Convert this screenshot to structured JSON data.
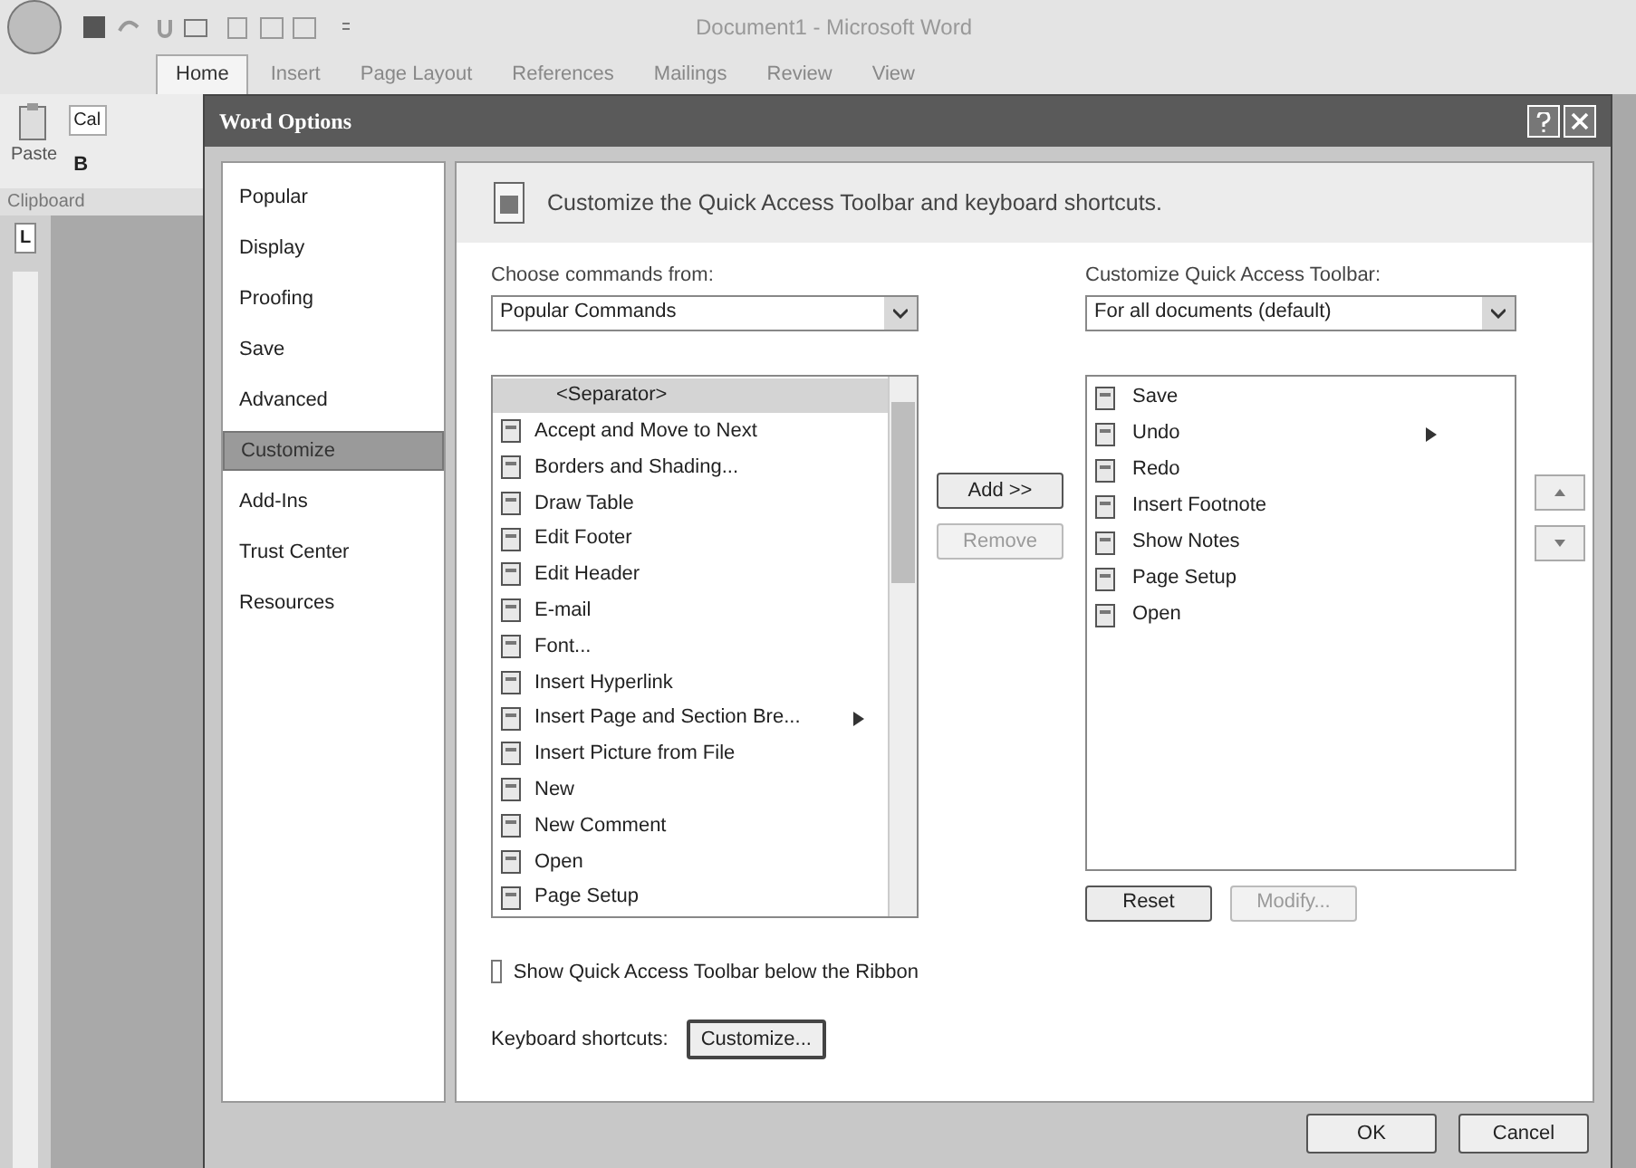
{
  "word_window": {
    "title": "Document1 - Microsoft Word",
    "ribbon_tabs": [
      {
        "label": "Home",
        "selected": true
      },
      {
        "label": "Insert",
        "selected": false
      },
      {
        "label": "Page Layout",
        "selected": false
      },
      {
        "label": "References",
        "selected": false
      },
      {
        "label": "Mailings",
        "selected": false
      },
      {
        "label": "Review",
        "selected": false
      },
      {
        "label": "View",
        "selected": false
      }
    ],
    "ribbon": {
      "paste": "Paste",
      "font_box": "Cal",
      "bold": "B",
      "group": "Clipboard"
    },
    "ruler_tab": "L"
  },
  "dialog": {
    "title": "Word Options",
    "nav": [
      {
        "label": "Popular",
        "selected": false
      },
      {
        "label": "Display",
        "selected": false
      },
      {
        "label": "Proofing",
        "selected": false
      },
      {
        "label": "Save",
        "selected": false
      },
      {
        "label": "Advanced",
        "selected": false
      },
      {
        "label": "Customize",
        "selected": true
      },
      {
        "label": "Add-Ins",
        "selected": false
      },
      {
        "label": "Trust Center",
        "selected": false
      },
      {
        "label": "Resources",
        "selected": false
      }
    ],
    "heading": "Customize the Quick Access Toolbar and keyboard shortcuts.",
    "choose_label": "Choose commands from:",
    "choose_value": "Popular Commands",
    "commands": [
      {
        "label": "<Separator>",
        "selected": true,
        "submenu": false
      },
      {
        "label": "Accept and Move to Next",
        "selected": false,
        "submenu": false
      },
      {
        "label": "Borders and Shading...",
        "selected": false,
        "submenu": false
      },
      {
        "label": "Draw Table",
        "selected": false,
        "submenu": false
      },
      {
        "label": "Edit Footer",
        "selected": false,
        "submenu": false
      },
      {
        "label": "Edit Header",
        "selected": false,
        "submenu": false
      },
      {
        "label": "E-mail",
        "selected": false,
        "submenu": false
      },
      {
        "label": "Font...",
        "selected": false,
        "submenu": false
      },
      {
        "label": "Insert Hyperlink",
        "selected": false,
        "submenu": false
      },
      {
        "label": "Insert Page and Section Bre...",
        "selected": false,
        "submenu": true
      },
      {
        "label": "Insert Picture from File",
        "selected": false,
        "submenu": false
      },
      {
        "label": "New",
        "selected": false,
        "submenu": false
      },
      {
        "label": "New Comment",
        "selected": false,
        "submenu": false
      },
      {
        "label": "Open",
        "selected": false,
        "submenu": false
      },
      {
        "label": "Page Setup",
        "selected": false,
        "submenu": false
      }
    ],
    "add_button": {
      "label": "Add >>",
      "disabled": false
    },
    "remove_button": {
      "label": "Remove",
      "disabled": true
    },
    "toolbar_label": "Customize Quick Access Toolbar:",
    "toolbar_value": "For all documents (default)",
    "toolbar_items": [
      {
        "label": "Save",
        "submenu": false
      },
      {
        "label": "Undo",
        "submenu": true
      },
      {
        "label": "Redo",
        "submenu": false
      },
      {
        "label": "Insert Footnote",
        "submenu": false
      },
      {
        "label": "Show Notes",
        "submenu": false
      },
      {
        "label": "Page Setup",
        "submenu": false
      },
      {
        "label": "Open",
        "submenu": false
      }
    ],
    "reset_button": {
      "label": "Reset",
      "disabled": false
    },
    "modify_button": {
      "label": "Modify...",
      "disabled": true
    },
    "show_below": {
      "label": "Show Quick Access Toolbar below the Ribbon",
      "checked": false
    },
    "shortcuts_label": "Keyboard shortcuts:",
    "shortcuts_button": "Customize...",
    "ok": "OK",
    "cancel": "Cancel"
  }
}
